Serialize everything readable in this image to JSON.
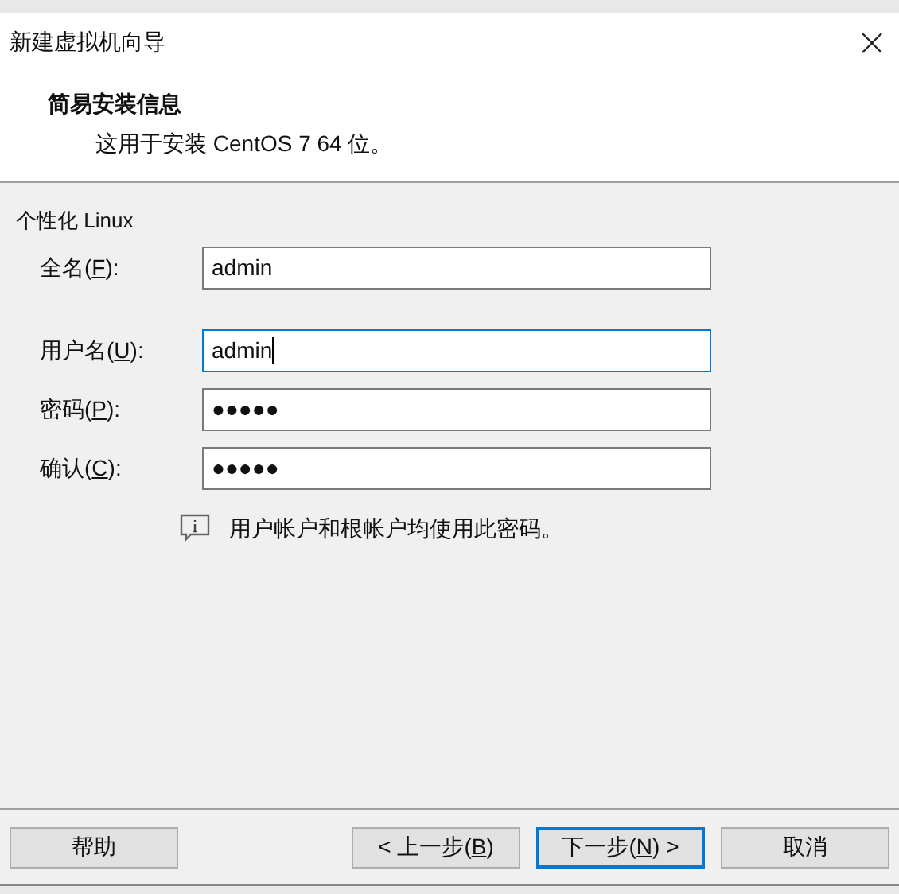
{
  "window": {
    "title": "新建虚拟机向导"
  },
  "header": {
    "title": "简易安装信息",
    "subtitle": "这用于安装 CentOS 7 64 位。"
  },
  "group": {
    "title": "个性化 Linux"
  },
  "field_groups": [
    {
      "fields": [
        {
          "label": "全名(",
          "accel": "F",
          "label_end": "):",
          "value": "admin",
          "focused": false
        }
      ]
    },
    {
      "fields": [
        {
          "label": "用户名(",
          "accel": "U",
          "label_end": "):",
          "value": "admin",
          "focused": true
        },
        {
          "label": "密码(",
          "accel": "P",
          "label_end": "):",
          "value": "●●●●●",
          "focused": false
        },
        {
          "label": "确认(",
          "accel": "C",
          "label_end": "):",
          "value": "●●●●●",
          "focused": false
        }
      ]
    }
  ],
  "note": "用户帐户和根帐户均使用此密码。",
  "buttons": [
    {
      "label": "帮助",
      "default": false
    },
    {
      "label": "< 上一步(",
      "accel": "B",
      "label_end": ")",
      "default": false
    },
    {
      "label": "下一步(",
      "accel": "N",
      "label_end": ") >",
      "default": true
    },
    {
      "label": "取消",
      "default": false
    }
  ]
}
